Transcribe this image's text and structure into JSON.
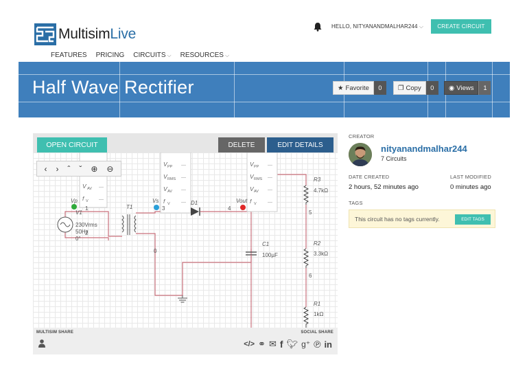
{
  "header": {
    "logo_text_a": "Multisim",
    "logo_text_b": "Live",
    "nav": [
      {
        "label": "FEATURES",
        "has_caret": false
      },
      {
        "label": "PRICING",
        "has_caret": false
      },
      {
        "label": "CIRCUITS",
        "has_caret": true
      },
      {
        "label": "RESOURCES",
        "has_caret": true
      }
    ],
    "bell_icon": "bell-icon",
    "greeting": "HELLO, NITYANANDMALHAR244",
    "create_label": "CREATE CIRCUIT"
  },
  "banner": {
    "title": "Half Wave Rectifier",
    "favorite_label": "Favorite",
    "favorite_count": "0",
    "copy_label": "Copy",
    "copy_count": "0",
    "views_label": "Views",
    "views_count": "1"
  },
  "circuit": {
    "open_label": "OPEN CIRCUIT",
    "delete_label": "DELETE",
    "edit_label": "EDIT DETAILS",
    "toolbar": [
      "‹",
      "›",
      "ˆ",
      "ˇ",
      "⊕",
      "⊖"
    ],
    "labels": {
      "vp": "Vp",
      "v1": "V1",
      "v1_val1": "230Vrms",
      "v1_val2": "50Hz",
      "v1_val3": "0°",
      "t1": "T1",
      "vs": "Vs",
      "d1": "D1",
      "vout": "Vout",
      "n1": "1",
      "n2": "2",
      "n3": "3",
      "n4": "4",
      "n5": "5",
      "n6": "6",
      "n0": "0",
      "c1": "C1",
      "c1_val": "100µF",
      "r3": "R3",
      "r3_val": "4.7kΩ",
      "r2": "R2",
      "r2_val": "3.3kΩ",
      "r1": "R1",
      "r1_val": "1kΩ"
    },
    "probe_rows": [
      "V",
      "V",
      "V",
      "f"
    ],
    "probe_subs": [
      "PP",
      "RMS",
      "AV",
      "V"
    ],
    "probe_dash": "—",
    "share_left": "MULTISIM SHARE",
    "share_right": "SOCIAL SHARE",
    "social_icons": [
      "embed-icon",
      "link-icon",
      "email-icon",
      "facebook-icon",
      "twitter-icon",
      "googleplus-icon",
      "pinterest-icon",
      "linkedin-icon"
    ]
  },
  "sidebar": {
    "creator_label": "CREATOR",
    "creator_name": "nityanandmalhar244",
    "creator_circuits": "7 Circuits",
    "date_created_label": "DATE CREATED",
    "date_created": "2 hours, 52 minutes ago",
    "last_modified_label": "LAST MODIFIED",
    "last_modified": "0 minutes ago",
    "tags_label": "TAGS",
    "tags_text": "This circuit has no tags currently.",
    "edit_tags_label": "EDIT TAGS"
  },
  "colors": {
    "teal": "#3fbfb0",
    "banner_blue": "#3f7fbc",
    "wire": "#c9707c",
    "dark_blue": "#2c5e8d"
  }
}
